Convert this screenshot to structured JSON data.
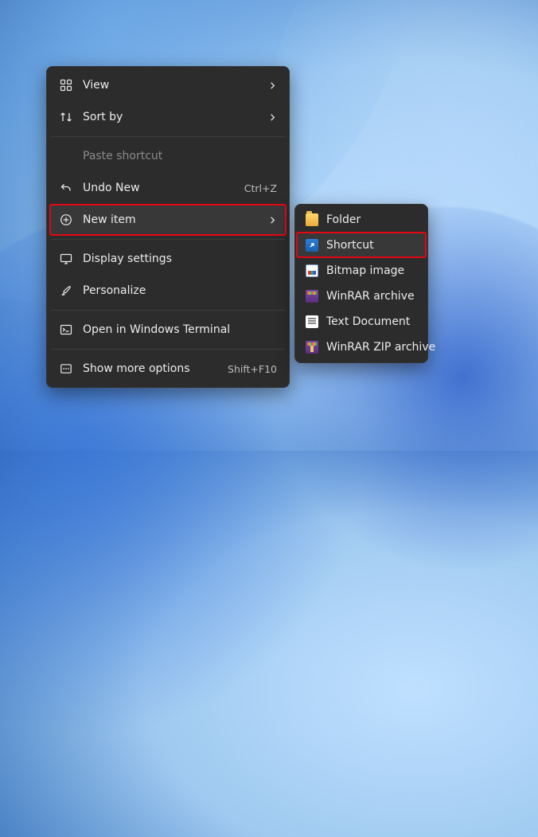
{
  "main_menu": {
    "view": {
      "label": "View"
    },
    "sort_by": {
      "label": "Sort by"
    },
    "paste_shortcut": {
      "label": "Paste shortcut"
    },
    "undo": {
      "label": "Undo New",
      "accel": "Ctrl+Z"
    },
    "new_item": {
      "label": "New item"
    },
    "display": {
      "label": "Display settings"
    },
    "personalize": {
      "label": "Personalize"
    },
    "terminal": {
      "label": "Open in Windows Terminal"
    },
    "more": {
      "label": "Show more options",
      "accel": "Shift+F10"
    }
  },
  "new_submenu": {
    "folder": {
      "label": "Folder"
    },
    "shortcut": {
      "label": "Shortcut"
    },
    "bmp": {
      "label": "Bitmap image"
    },
    "rar": {
      "label": "WinRAR archive"
    },
    "txt": {
      "label": "Text Document"
    },
    "zip": {
      "label": "WinRAR ZIP archive"
    }
  },
  "highlights": {
    "main": "new_item",
    "sub": "shortcut"
  },
  "colors": {
    "menu_bg": "#2c2c2c",
    "hover_bg": "#383838",
    "highlight_border": "#e30613"
  }
}
